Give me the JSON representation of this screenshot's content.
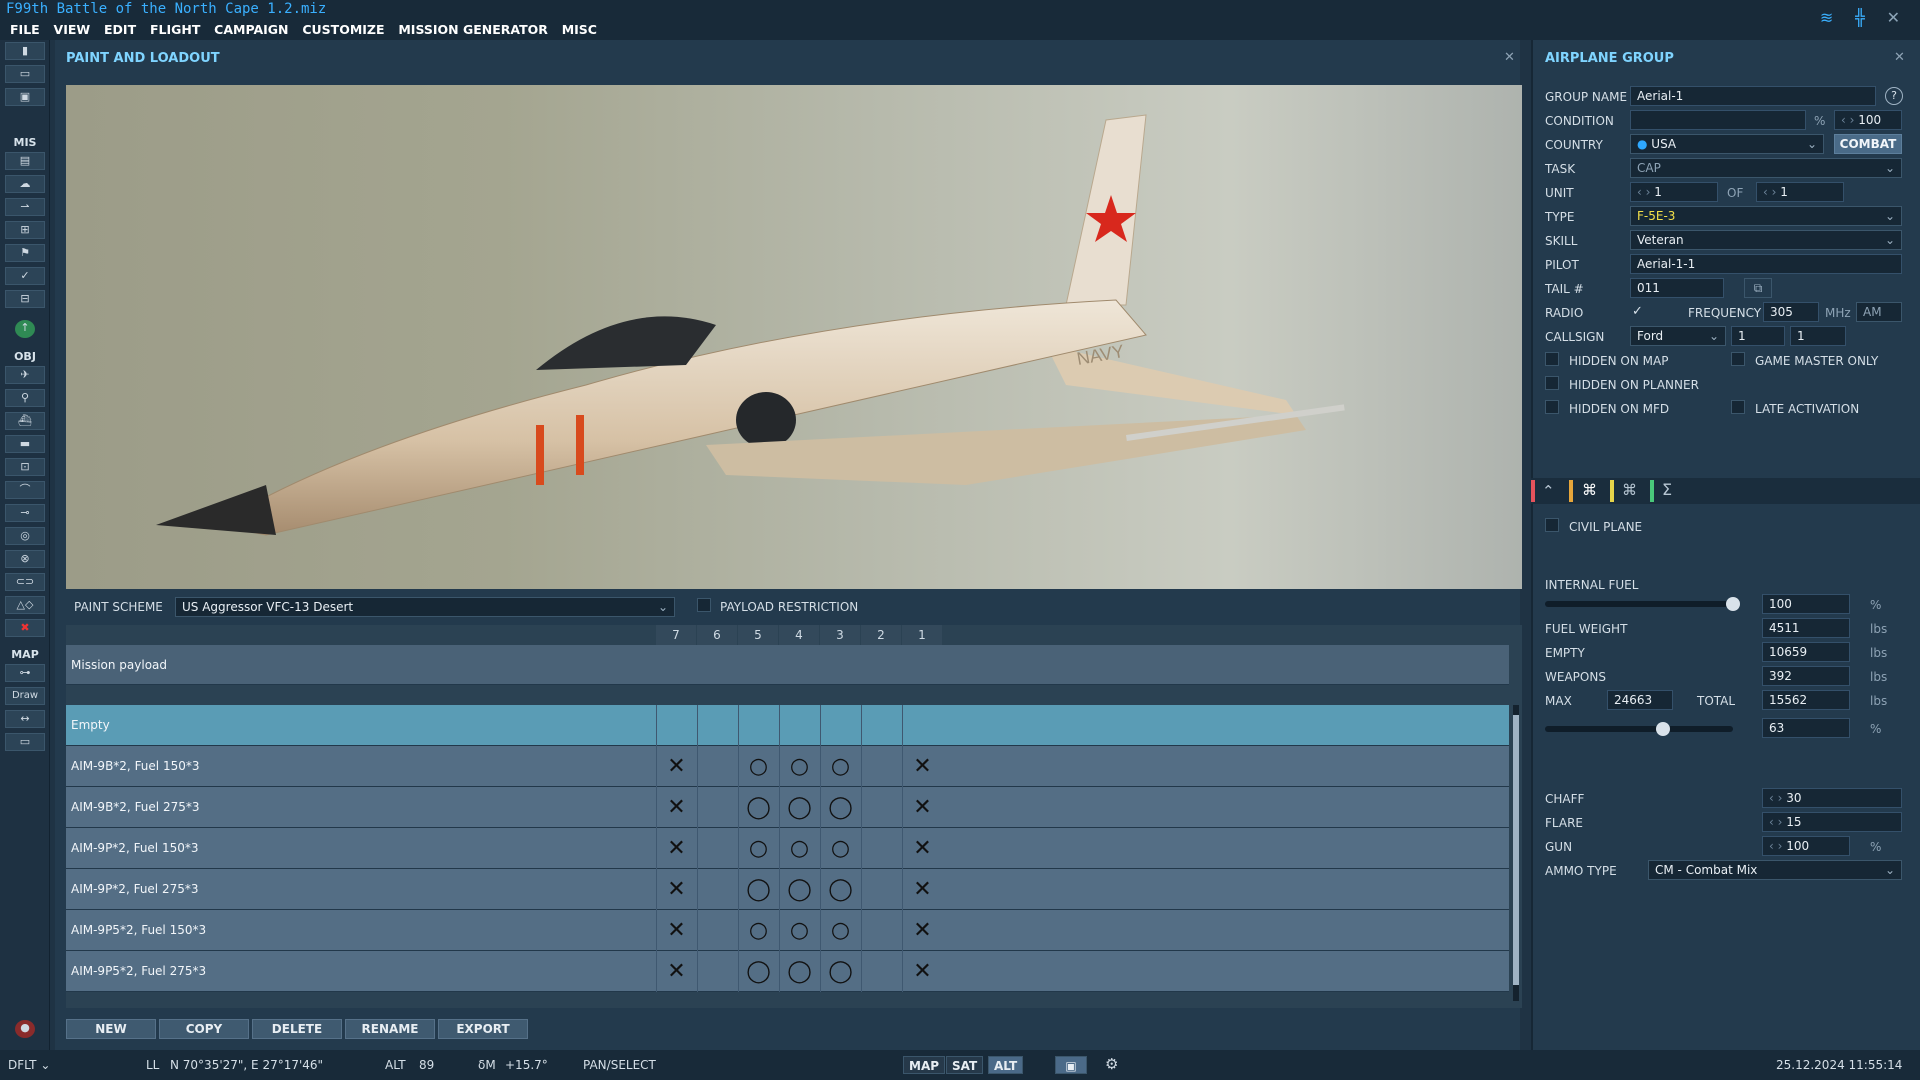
{
  "window": {
    "title": "F99th Battle of the North Cape 1.2.miz"
  },
  "menu": [
    "FILE",
    "VIEW",
    "EDIT",
    "FLIGHT",
    "CAMPAIGN",
    "CUSTOMIZE",
    "MISSION GENERATOR",
    "MISC"
  ],
  "left_toolbar": {
    "label_mis": "MIS",
    "label_obj": "OBJ",
    "label_map": "MAP",
    "draw_label": "Draw"
  },
  "paint_panel": {
    "title": "PAINT AND LOADOUT",
    "paint_scheme_label": "PAINT SCHEME",
    "paint_scheme_value": "US Aggressor VFC-13 Desert",
    "payload_restriction_label": "PAYLOAD RESTRICTION",
    "pylons": [
      "7",
      "6",
      "5",
      "4",
      "3",
      "2",
      "1"
    ],
    "mission_payload_label": "Mission payload",
    "rows": [
      {
        "name": "Empty",
        "selected": true,
        "marks": [
          "",
          "",
          "",
          "",
          "",
          "",
          ""
        ]
      },
      {
        "name": "AIM-9B*2, Fuel 150*3",
        "marks": [
          "✕",
          "",
          "○",
          "○",
          "○",
          "",
          "✕"
        ]
      },
      {
        "name": "AIM-9B*2, Fuel 275*3",
        "marks": [
          "✕",
          "",
          "◯",
          "◯",
          "◯",
          "",
          "✕"
        ]
      },
      {
        "name": "AIM-9P*2, Fuel 150*3",
        "marks": [
          "✕",
          "",
          "○",
          "○",
          "○",
          "",
          "✕"
        ]
      },
      {
        "name": "AIM-9P*2, Fuel 275*3",
        "marks": [
          "✕",
          "",
          "◯",
          "◯",
          "◯",
          "",
          "✕"
        ]
      },
      {
        "name": "AIM-9P5*2, Fuel 150*3",
        "marks": [
          "✕",
          "",
          "○",
          "○",
          "○",
          "",
          "✕"
        ]
      },
      {
        "name": "AIM-9P5*2, Fuel 275*3",
        "marks": [
          "✕",
          "",
          "◯",
          "◯",
          "◯",
          "",
          "✕"
        ]
      }
    ],
    "buttons": [
      "NEW",
      "COPY",
      "DELETE",
      "RENAME",
      "EXPORT"
    ]
  },
  "airplane_group": {
    "title": "AIRPLANE GROUP",
    "group_name_label": "GROUP NAME",
    "group_name": "Aerial-1",
    "condition_label": "CONDITION",
    "condition_unit": "%",
    "condition_value": "100",
    "country_label": "COUNTRY",
    "country": "USA",
    "combat_button": "COMBAT",
    "task_label": "TASK",
    "task": "CAP",
    "unit_label": "UNIT",
    "unit_value": "1",
    "of_label": "OF",
    "of_value": "1",
    "type_label": "TYPE",
    "type": "F-5E-3",
    "skill_label": "SKILL",
    "skill": "Veteran",
    "pilot_label": "PILOT",
    "pilot": "Aerial-1-1",
    "tail_label": "TAIL #",
    "tail": "011",
    "radio_label": "RADIO",
    "frequency_label": "FREQUENCY",
    "frequency": "305",
    "mhz": "MHz",
    "modulation": "AM",
    "callsign_label": "CALLSIGN",
    "callsign": "Ford",
    "callsign_n1": "1",
    "callsign_n2": "1",
    "hidden_on_map": "HIDDEN ON MAP",
    "game_master_only": "GAME MASTER ONLY",
    "hidden_on_planner": "HIDDEN ON PLANNER",
    "hidden_on_mfd": "HIDDEN ON MFD",
    "late_activation": "LATE ACTIVATION",
    "civil_plane": "CIVIL PLANE",
    "tab_sigma": "Σ",
    "internal_fuel_label": "INTERNAL FUEL",
    "internal_fuel": "100",
    "internal_fuel_fraction": 1.0,
    "fuel_weight_label": "FUEL WEIGHT",
    "fuel_weight": "4511",
    "empty_label": "EMPTY",
    "empty": "10659",
    "weapons_label": "WEAPONS",
    "weapons": "392",
    "max_label": "MAX",
    "max": "24663",
    "total_label": "TOTAL",
    "total": "15562",
    "load_percent": "63",
    "load_fraction": 0.63,
    "lbs": "lbs",
    "pct": "%",
    "chaff_label": "CHAFF",
    "chaff": "30",
    "flare_label": "FLARE",
    "flare": "15",
    "gun_label": "GUN",
    "gun": "100",
    "ammo_type_label": "AMMO TYPE",
    "ammo_type": "CM - Combat Mix"
  },
  "status_bar": {
    "mode": "DFLT",
    "ll_label": "LL",
    "ll_value": "N 70°35'27\", E 27°17'46\"",
    "alt_label": "ALT",
    "alt_value": "89",
    "dm_label": "δM",
    "dm_value": "+15.7°",
    "pan_select": "PAN/SELECT",
    "map_btn": "MAP",
    "sat_btn": "SAT",
    "alt_btn": "ALT",
    "datetime": "25.12.2024 11:55:14"
  },
  "colors": {
    "accent": "#7fd4ff",
    "title": "#3ab0ff",
    "selected_row": "#5a9cb5",
    "combat_bg": "#4a6b88"
  }
}
